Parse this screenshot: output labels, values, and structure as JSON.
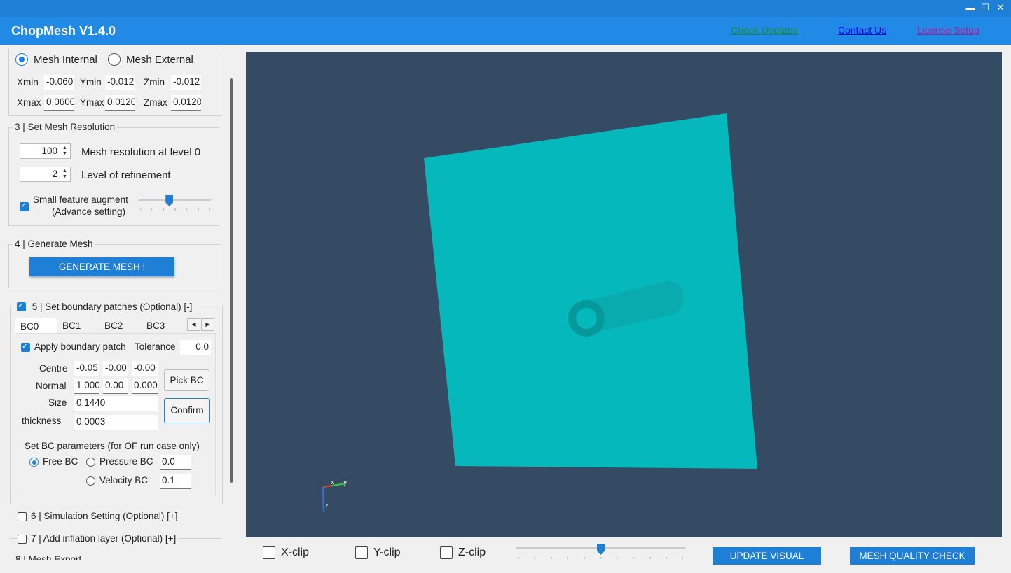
{
  "app": {
    "title": "ChopMesh V1.4.0",
    "links": {
      "check_updates": "Check Updates",
      "contact_us": "Contact Us",
      "license_setup": "License Setup"
    },
    "window": {
      "minimize": "▬",
      "maximize": "☐",
      "close": "✕"
    }
  },
  "domain": {
    "mesh_internal": "Mesh Internal",
    "mesh_external": "Mesh External",
    "selected": "Mesh Internal",
    "xmin_label": "Xmin",
    "xmin": "-0.060",
    "ymin_label": "Ymin",
    "ymin": "-0.012",
    "zmin_label": "Zmin",
    "zmin": "-0.012",
    "xmax_label": "Xmax",
    "xmax": "0.0600",
    "ymax_label": "Ymax",
    "ymax": "0.0120",
    "zmax_label": "Zmax",
    "zmax": "0.0120"
  },
  "resolution": {
    "title": "3 | Set Mesh  Resolution",
    "level0_value": "100",
    "level0_label": "Mesh resolution at level 0",
    "refine_value": "2",
    "refine_label": "Level of refinement",
    "feature_label_1": "Small feature augment",
    "feature_label_2": "(Advance setting)",
    "feature_checked": true,
    "feature_slider_fraction": 0.43
  },
  "generate": {
    "title": "4  | Generate Mesh",
    "button": "GENERATE MESH !"
  },
  "boundary": {
    "title": "5 | Set boundary patches (Optional) [-]",
    "checked": true,
    "tabs": [
      "BC0",
      "BC1",
      "BC2",
      "BC3"
    ],
    "active_tab": "BC0",
    "apply_label": "Apply boundary patch",
    "tolerance_label": "Tolerance",
    "tolerance": "0.0",
    "centre_label": "Centre",
    "centre": [
      "-0.05",
      "-0.00",
      "-0.00"
    ],
    "normal_label": "Normal",
    "normal": [
      "1.000",
      "0.00",
      "0.000"
    ],
    "size_label": "Size",
    "size": "0.1440",
    "thickness_label": "thickness",
    "thickness": "0.0003",
    "pick_button": "Pick BC",
    "confirm_button": "Confirm",
    "params_title": "Set BC parameters (for OF run case only)",
    "free_bc": "Free BC",
    "pressure_bc": "Pressure BC",
    "pressure_value": "0.0",
    "velocity_bc": "Velocity BC",
    "velocity_value": "0.1",
    "selected_bc": "Free BC"
  },
  "simulation": {
    "title": "6 | Simulation Setting (Optional) [+]",
    "checked": false
  },
  "inflation": {
    "title": "7 | Add inflation layer (Optional) [+]",
    "checked": false
  },
  "export": {
    "title": "8 | Mesh Export"
  },
  "bottom": {
    "xclip": "X-clip",
    "yclip": "Y-clip",
    "zclip": "Z-clip",
    "clip_slider_fraction": 0.5,
    "update_button": "UPDATE VISUAL",
    "quality_button": "MESH QUALITY CHECK"
  },
  "axes": {
    "x": "x",
    "y": "y",
    "z": "z"
  },
  "colors": {
    "accent": "#1e7fd6",
    "viewport_bg": "#344b63",
    "mesh_face": "#04b8bb",
    "link_green": "#1a8a3a",
    "link_blue": "#0000ee",
    "link_purple": "#b0189b"
  }
}
